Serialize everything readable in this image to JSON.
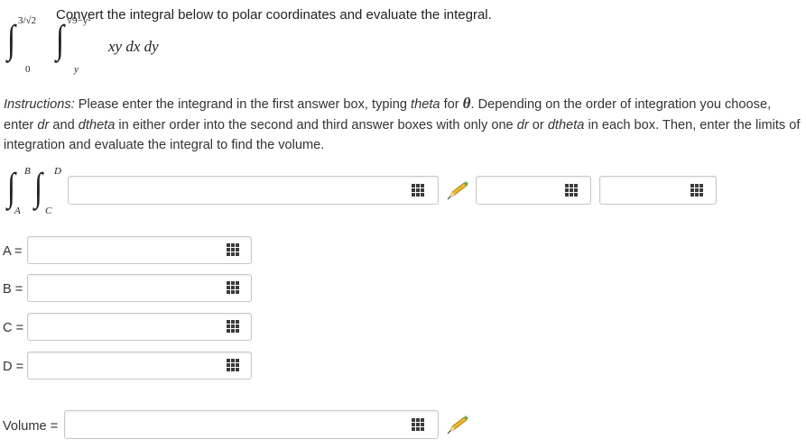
{
  "question": {
    "prompt": "Convert the integral below to polar coordinates and evaluate the integral.",
    "outer_upper": "3/√2",
    "outer_lower": "0",
    "inner_upper": "√9−y²",
    "inner_lower": "y",
    "integrand": "xy dx dy"
  },
  "instructions": {
    "lead": "Instructions:",
    "part1": " Please enter the integrand in the first answer box, typing ",
    "theta_word": "theta",
    "part2": " for ",
    "theta_symbol": "θ",
    "part3": ". Depending on the order of integration you choose, enter ",
    "dr1": "dr",
    "part4": " and ",
    "dtheta1": "dtheta",
    "part5": " in either order into the second and third answer boxes with only one ",
    "dr2": "dr",
    "part6": " or ",
    "dtheta2": "dtheta",
    "part7": " in each box. Then, enter the limits of integration and evaluate the integral to find the volume."
  },
  "answer_integral": {
    "upper_outer": "B",
    "lower_outer": "A",
    "upper_inner": "D",
    "lower_inner": "C",
    "integrand_value": "",
    "diff1_value": "",
    "diff2_value": ""
  },
  "limits": [
    {
      "label": "A =",
      "value": ""
    },
    {
      "label": "B =",
      "value": ""
    },
    {
      "label": "C =",
      "value": ""
    },
    {
      "label": "D =",
      "value": ""
    }
  ],
  "volume": {
    "label": "Volume =",
    "value": ""
  },
  "icons": {
    "keypad": "keypad-icon",
    "pencil": "pencil-icon"
  },
  "colors": {
    "field_border": "#c8c8c8",
    "pencil_body": "#e8b92e",
    "pencil_tip": "#6aa84f"
  }
}
